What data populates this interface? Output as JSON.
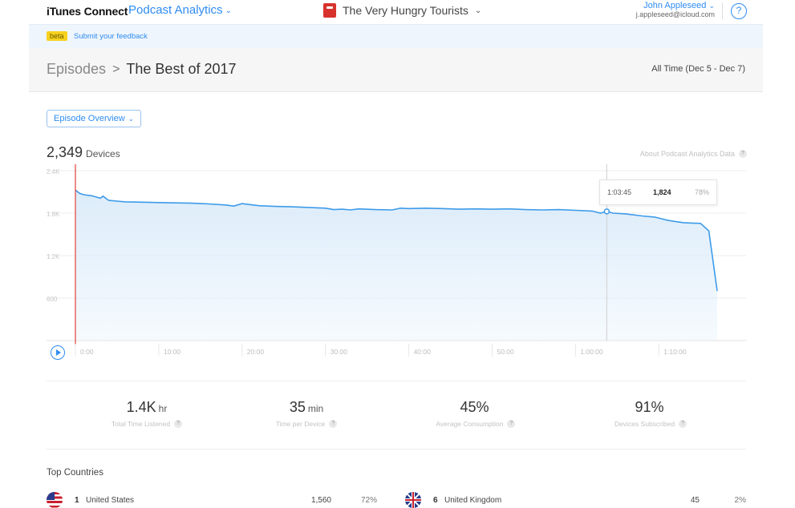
{
  "topbar": {
    "brand": "iTunes Connect",
    "app": "Podcast Analytics",
    "podcast_name": "The Very Hungry Tourists",
    "user_name": "John Appleseed",
    "user_email": "j.appleseed@icloud.com",
    "help_label": "?"
  },
  "beta": {
    "badge": "beta",
    "feedback": "Submit your feedback"
  },
  "header": {
    "breadcrumb_parent": "Episodes",
    "breadcrumb_separator": ">",
    "breadcrumb_current": "The Best of 2017",
    "date_range": "All Time (Dec 5 - Dec 7)"
  },
  "view_selector": {
    "label": "Episode Overview"
  },
  "summary": {
    "count": "2,349",
    "unit": "Devices",
    "about": "About Podcast Analytics Data"
  },
  "tooltip": {
    "time": "1:03:45",
    "value": "1,824",
    "percent": "78%"
  },
  "colors": {
    "accent": "#2f8cf0",
    "line": "#3d9be9",
    "fill": "#dcecfa",
    "playhead": "#e0403a"
  },
  "chart_data": {
    "type": "area",
    "title": "",
    "xlabel": "",
    "ylabel": "Devices",
    "x_ticks": [
      "0:00",
      "10:00",
      "20:00",
      "30:00",
      "40:00",
      "50:00",
      "1:00:00",
      "1:10:00"
    ],
    "y_ticks": [
      "600",
      "1.2K",
      "1.8K",
      "2.4K"
    ],
    "ylim": [
      0,
      2400
    ],
    "xlim_minutes": [
      0,
      77
    ],
    "grid": true,
    "cursor_minute": 63.75,
    "series": [
      {
        "x": [
          0,
          0.5,
          1,
          2,
          3,
          3.3,
          4,
          5,
          6,
          8,
          10,
          12,
          14,
          16,
          18,
          19,
          20,
          21,
          22,
          24,
          26,
          28,
          30,
          31,
          32,
          33,
          34,
          36,
          38,
          39,
          40,
          42,
          44,
          46,
          48,
          50,
          52,
          54,
          56,
          58,
          60,
          62,
          63,
          63.75,
          64.5,
          66,
          68,
          69.5,
          71,
          72,
          73,
          74,
          75,
          76,
          77
        ],
        "y": [
          2125,
          2080,
          2060,
          2045,
          2010,
          2040,
          1980,
          1970,
          1960,
          1955,
          1950,
          1945,
          1940,
          1930,
          1915,
          1900,
          1935,
          1920,
          1905,
          1895,
          1890,
          1880,
          1870,
          1850,
          1855,
          1845,
          1860,
          1850,
          1845,
          1870,
          1865,
          1870,
          1865,
          1855,
          1860,
          1855,
          1860,
          1850,
          1845,
          1850,
          1840,
          1830,
          1800,
          1824,
          1800,
          1790,
          1760,
          1745,
          1700,
          1680,
          1665,
          1660,
          1655,
          1550,
          700
        ]
      }
    ]
  },
  "stats": [
    {
      "value": "1.4K",
      "unit": "hr",
      "label": "Total Time Listened"
    },
    {
      "value": "35",
      "unit": "min",
      "label": "Time per Device"
    },
    {
      "value": "45%",
      "unit": "",
      "label": "Average Consumption"
    },
    {
      "value": "91%",
      "unit": "",
      "label": "Devices Subscribed"
    }
  ],
  "countries": {
    "title": "Top Countries",
    "rows": [
      {
        "rank": "1",
        "name": "United States",
        "devices": "1,560",
        "percent": "72%",
        "flag": "us-flag-icon"
      },
      {
        "rank": "6",
        "name": "United Kingdom",
        "devices": "45",
        "percent": "2%",
        "flag": "uk-flag-icon"
      }
    ]
  }
}
